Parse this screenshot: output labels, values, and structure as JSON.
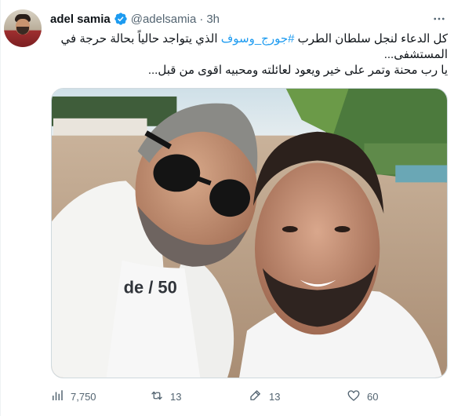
{
  "tweet": {
    "display_name": "adel samia",
    "handle": "@adelsamia",
    "separator": "·",
    "time": "3h",
    "text_line1_before": "كل الدعاء لنجل سلطان الطرب ",
    "hashtag": "#جورج_وسوف",
    "text_line1_after": " الذي يتواجد حالياً بحالة حرجة في المستشفى...",
    "text_line2": "يا رب محنة وتمر على خير ويعود لعائلته ومحبيه اقوى من قبل...",
    "media_text": "de / 50"
  },
  "metrics": {
    "views": "7,750",
    "retweets": "13",
    "quotes": "13",
    "likes": "60"
  },
  "colors": {
    "accent": "#1d9bf0",
    "secondary_text": "#536471"
  },
  "icons": {
    "more": "more-dots-icon",
    "verified": "verified-badge-icon",
    "views": "analytics-icon",
    "retweet": "retweet-icon",
    "quote": "quote-icon",
    "like": "heart-icon"
  }
}
